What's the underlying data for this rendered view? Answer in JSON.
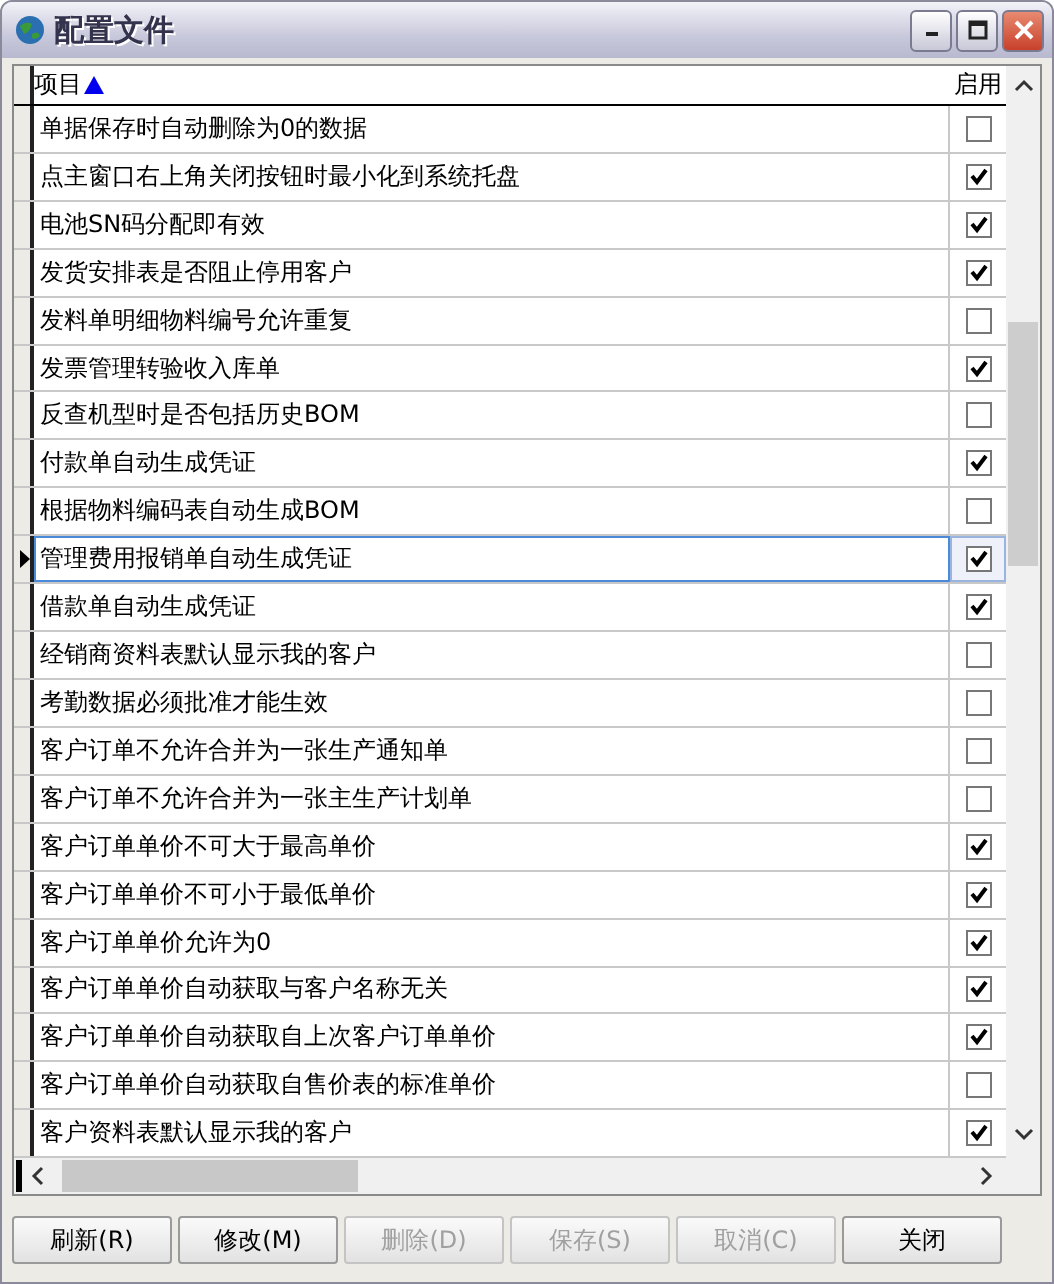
{
  "window": {
    "title": "配置文件"
  },
  "table": {
    "columns": [
      {
        "label": "项目",
        "sorted": true
      },
      {
        "label": "启用",
        "sorted": false
      }
    ],
    "rows": [
      {
        "item": "单据保存时自动删除为0的数据",
        "enabled": false,
        "selected": false
      },
      {
        "item": "点主窗口右上角关闭按钮时最小化到系统托盘",
        "enabled": true,
        "selected": false
      },
      {
        "item": "电池SN码分配即有效",
        "enabled": true,
        "selected": false
      },
      {
        "item": "发货安排表是否阻止停用客户",
        "enabled": true,
        "selected": false
      },
      {
        "item": "发料单明细物料编号允许重复",
        "enabled": false,
        "selected": false
      },
      {
        "item": "发票管理转验收入库单",
        "enabled": true,
        "selected": false
      },
      {
        "item": "反查机型时是否包括历史BOM",
        "enabled": false,
        "selected": false
      },
      {
        "item": "付款单自动生成凭证",
        "enabled": true,
        "selected": false
      },
      {
        "item": "根据物料编码表自动生成BOM",
        "enabled": false,
        "selected": false
      },
      {
        "item": "管理费用报销单自动生成凭证",
        "enabled": true,
        "selected": true
      },
      {
        "item": "借款单自动生成凭证",
        "enabled": true,
        "selected": false
      },
      {
        "item": "经销商资料表默认显示我的客户",
        "enabled": false,
        "selected": false
      },
      {
        "item": "考勤数据必须批准才能生效",
        "enabled": false,
        "selected": false
      },
      {
        "item": "客户订单不允许合并为一张生产通知单",
        "enabled": false,
        "selected": false
      },
      {
        "item": "客户订单不允许合并为一张主生产计划单",
        "enabled": false,
        "selected": false
      },
      {
        "item": "客户订单单价不可大于最高单价",
        "enabled": true,
        "selected": false
      },
      {
        "item": "客户订单单价不可小于最低单价",
        "enabled": true,
        "selected": false
      },
      {
        "item": "客户订单单价允许为0",
        "enabled": true,
        "selected": false
      },
      {
        "item": "客户订单单价自动获取与客户名称无关",
        "enabled": true,
        "selected": false
      },
      {
        "item": "客户订单单价自动获取自上次客户订单单价",
        "enabled": true,
        "selected": false
      },
      {
        "item": "客户订单单价自动获取自售价表的标准单价",
        "enabled": false,
        "selected": false
      },
      {
        "item": "客户资料表默认显示我的客户",
        "enabled": true,
        "selected": false
      }
    ]
  },
  "buttons": [
    {
      "label": "刷新(R)",
      "disabled": false
    },
    {
      "label": "修改(M)",
      "disabled": false
    },
    {
      "label": "删除(D)",
      "disabled": true
    },
    {
      "label": "保存(S)",
      "disabled": true
    },
    {
      "label": "取消(C)",
      "disabled": true
    },
    {
      "label": "关闭",
      "disabled": false
    }
  ]
}
